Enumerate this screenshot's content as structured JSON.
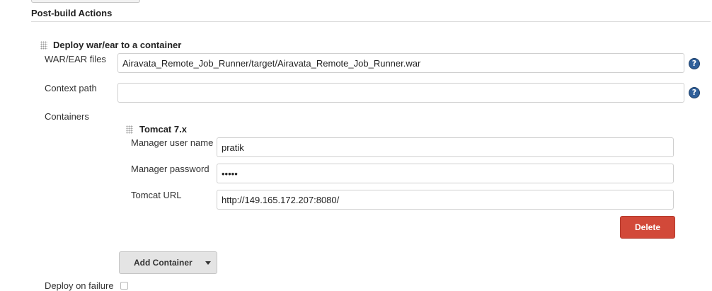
{
  "section": {
    "title": "Post-build Actions"
  },
  "deploy": {
    "title": "Deploy war/ear to a container",
    "war_label": "WAR/EAR files",
    "war_value": "Airavata_Remote_Job_Runner/target/Airavata_Remote_Job_Runner.war",
    "context_label": "Context path",
    "context_value": "",
    "containers_label": "Containers",
    "help_glyph": "?",
    "help_icon": "question-circle-icon",
    "on_failure_label": "Deploy on failure",
    "on_failure_checked": false
  },
  "tomcat": {
    "title": "Tomcat 7.x",
    "user_label": "Manager user name",
    "user_value": "pratik",
    "password_label": "Manager password",
    "password_value": "•••••",
    "url_label": "Tomcat URL",
    "url_value": "http://149.165.172.207:8080/",
    "delete_label": "Delete"
  },
  "actions": {
    "add_container_label": "Add Container",
    "dropdown_icon": "caret-down-icon"
  },
  "colors": {
    "delete_bg": "#d24939",
    "help_bg": "#2f5f9a",
    "button_bg": "#e4e4e4",
    "rule": "#dddddd"
  }
}
